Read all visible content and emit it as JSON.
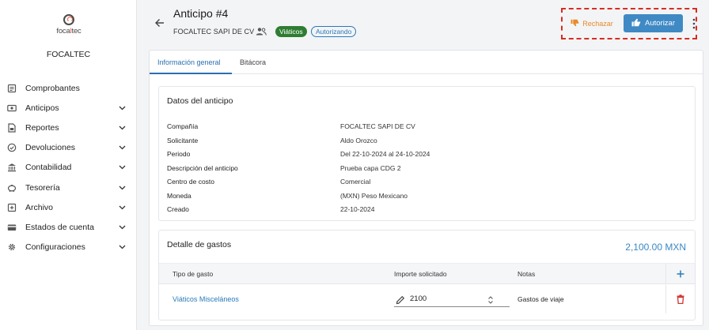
{
  "sidebar": {
    "logo_text_a": "foca",
    "logo_text_b": "l",
    "logo_text_c": "tec",
    "company": "FOCALTEC",
    "items": [
      {
        "label": "Comprobantes",
        "icon": "receipt-icon",
        "expandable": false
      },
      {
        "label": "Anticipos",
        "icon": "cash-icon",
        "expandable": true
      },
      {
        "label": "Reportes",
        "icon": "report-icon",
        "expandable": true
      },
      {
        "label": "Devoluciones",
        "icon": "refund-icon",
        "expandable": true
      },
      {
        "label": "Contabilidad",
        "icon": "bank-icon",
        "expandable": true
      },
      {
        "label": "Tesorería",
        "icon": "piggy-bank-icon",
        "expandable": true
      },
      {
        "label": "Archivo",
        "icon": "archive-icon",
        "expandable": true
      },
      {
        "label": "Estados de cuenta",
        "icon": "statement-icon",
        "expandable": true
      },
      {
        "label": "Configuraciones",
        "icon": "gear-icon",
        "expandable": true
      }
    ]
  },
  "header": {
    "title": "Anticipo #4",
    "company": "FOCALTEC SAPI DE CV",
    "badge_type": "Viáticos",
    "badge_status": "Autorizando",
    "reject_label": "Rechazar",
    "authorize_label": "Autorizar"
  },
  "tabs": [
    {
      "label": "Información general",
      "active": true
    },
    {
      "label": "Bitácora",
      "active": false
    }
  ],
  "details": {
    "title": "Datos del anticipo",
    "rows": [
      {
        "key": "Compañía",
        "value": "FOCALTEC SAPI DE CV"
      },
      {
        "key": "Solicitante",
        "value": "Aldo Orozco"
      },
      {
        "key": "Periodo",
        "value": "Del 22-10-2024 al 24-10-2024"
      },
      {
        "key": "Descripción del anticipo",
        "value": "Prueba capa CDG 2"
      },
      {
        "key": "Centro de costo",
        "value": "Comercial"
      },
      {
        "key": "Moneda",
        "value": "(MXN) Peso Mexicano"
      },
      {
        "key": "Creado",
        "value": "22-10-2024"
      }
    ]
  },
  "expenses": {
    "title": "Detalle de gastos",
    "total": "2,100.00 MXN",
    "columns": [
      "Tipo de gasto",
      "Importe solicitado",
      "Notas"
    ],
    "rows": [
      {
        "tipo": "Viáticos Misceláneos",
        "importe": "2100",
        "notas": "Gastos de viaje"
      }
    ]
  },
  "colors": {
    "accent": "#3f8ac4",
    "success_badge": "#2e7d32",
    "reject": "#e68b2a",
    "delete": "#d32f2f",
    "highlight_box": "#d62d20"
  }
}
